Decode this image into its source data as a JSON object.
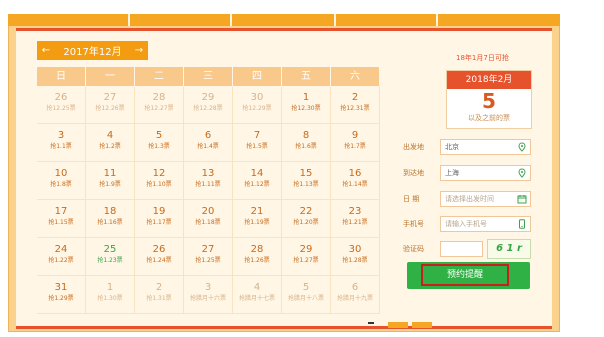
{
  "calendar": {
    "month_label": "2017年12月",
    "prev_arrow": "←",
    "next_arrow": "→",
    "weekdays": [
      "日",
      "一",
      "二",
      "三",
      "四",
      "五",
      "六"
    ],
    "weeks": [
      [
        {
          "day": "26",
          "sub": "抢12.25票",
          "state": "other"
        },
        {
          "day": "27",
          "sub": "抢12.26票",
          "state": "other"
        },
        {
          "day": "28",
          "sub": "抢12.27票",
          "state": "other"
        },
        {
          "day": "29",
          "sub": "抢12.28票",
          "state": "other"
        },
        {
          "day": "30",
          "sub": "抢12.29票",
          "state": "other"
        },
        {
          "day": "1",
          "sub": "抢12.30票",
          "state": "normal"
        },
        {
          "day": "2",
          "sub": "抢12.31票",
          "state": "normal"
        }
      ],
      [
        {
          "day": "3",
          "sub": "抢1.1票",
          "state": "normal"
        },
        {
          "day": "4",
          "sub": "抢1.2票",
          "state": "normal"
        },
        {
          "day": "5",
          "sub": "抢1.3票",
          "state": "normal"
        },
        {
          "day": "6",
          "sub": "抢1.4票",
          "state": "normal"
        },
        {
          "day": "7",
          "sub": "抢1.5票",
          "state": "normal"
        },
        {
          "day": "8",
          "sub": "抢1.6票",
          "state": "normal"
        },
        {
          "day": "9",
          "sub": "抢1.7票",
          "state": "normal"
        }
      ],
      [
        {
          "day": "10",
          "sub": "抢1.8票",
          "state": "normal"
        },
        {
          "day": "11",
          "sub": "抢1.9票",
          "state": "normal"
        },
        {
          "day": "12",
          "sub": "抢1.10票",
          "state": "normal"
        },
        {
          "day": "13",
          "sub": "抢1.11票",
          "state": "normal"
        },
        {
          "day": "14",
          "sub": "抢1.12票",
          "state": "normal"
        },
        {
          "day": "15",
          "sub": "抢1.13票",
          "state": "normal"
        },
        {
          "day": "16",
          "sub": "抢1.14票",
          "state": "normal"
        }
      ],
      [
        {
          "day": "17",
          "sub": "抢1.15票",
          "state": "normal"
        },
        {
          "day": "18",
          "sub": "抢1.16票",
          "state": "normal"
        },
        {
          "day": "19",
          "sub": "抢1.17票",
          "state": "normal"
        },
        {
          "day": "20",
          "sub": "抢1.18票",
          "state": "normal"
        },
        {
          "day": "21",
          "sub": "抢1.19票",
          "state": "normal"
        },
        {
          "day": "22",
          "sub": "抢1.20票",
          "state": "normal"
        },
        {
          "day": "23",
          "sub": "抢1.21票",
          "state": "normal"
        }
      ],
      [
        {
          "day": "24",
          "sub": "抢1.22票",
          "state": "normal"
        },
        {
          "day": "25",
          "sub": "抢1.23票",
          "state": "today"
        },
        {
          "day": "26",
          "sub": "抢1.24票",
          "state": "normal"
        },
        {
          "day": "27",
          "sub": "抢1.25票",
          "state": "normal"
        },
        {
          "day": "28",
          "sub": "抢1.26票",
          "state": "normal"
        },
        {
          "day": "29",
          "sub": "抢1.27票",
          "state": "normal"
        },
        {
          "day": "30",
          "sub": "抢1.28票",
          "state": "normal"
        }
      ],
      [
        {
          "day": "31",
          "sub": "抢1.29票",
          "state": "normal"
        },
        {
          "day": "1",
          "sub": "抢1.30票",
          "state": "other"
        },
        {
          "day": "2",
          "sub": "抢1.31票",
          "state": "other"
        },
        {
          "day": "3",
          "sub": "抢腊月十六票",
          "state": "other"
        },
        {
          "day": "4",
          "sub": "抢腊月十七票",
          "state": "other"
        },
        {
          "day": "5",
          "sub": "抢腊月十八票",
          "state": "other"
        },
        {
          "day": "6",
          "sub": "抢腊月十九票",
          "state": "other"
        }
      ]
    ]
  },
  "side": {
    "available_note": "18年1月7日可抢",
    "card_month": "2018年2月",
    "card_number": "5",
    "card_sub": "以及之前的票"
  },
  "form": {
    "depart_label": "出发地",
    "depart_value": "北京",
    "arrive_label": "到达地",
    "arrive_value": "上海",
    "date_label": "日 期",
    "date_placeholder": "请选择出发时间",
    "phone_label": "手机号",
    "phone_placeholder": "请输入手机号",
    "code_label": "验证码",
    "code_value": "",
    "captcha_text": "6 1 r"
  },
  "actions": {
    "reserve_label": "预约提醒"
  },
  "colors": {
    "accent_orange": "#f39c12",
    "accent_red": "#e6522c",
    "accent_green": "#2fb145",
    "panel_bg": "#fff6e6"
  },
  "icons": {
    "location": "location-pin-icon",
    "calendar": "calendar-icon",
    "phone": "mobile-phone-icon"
  }
}
